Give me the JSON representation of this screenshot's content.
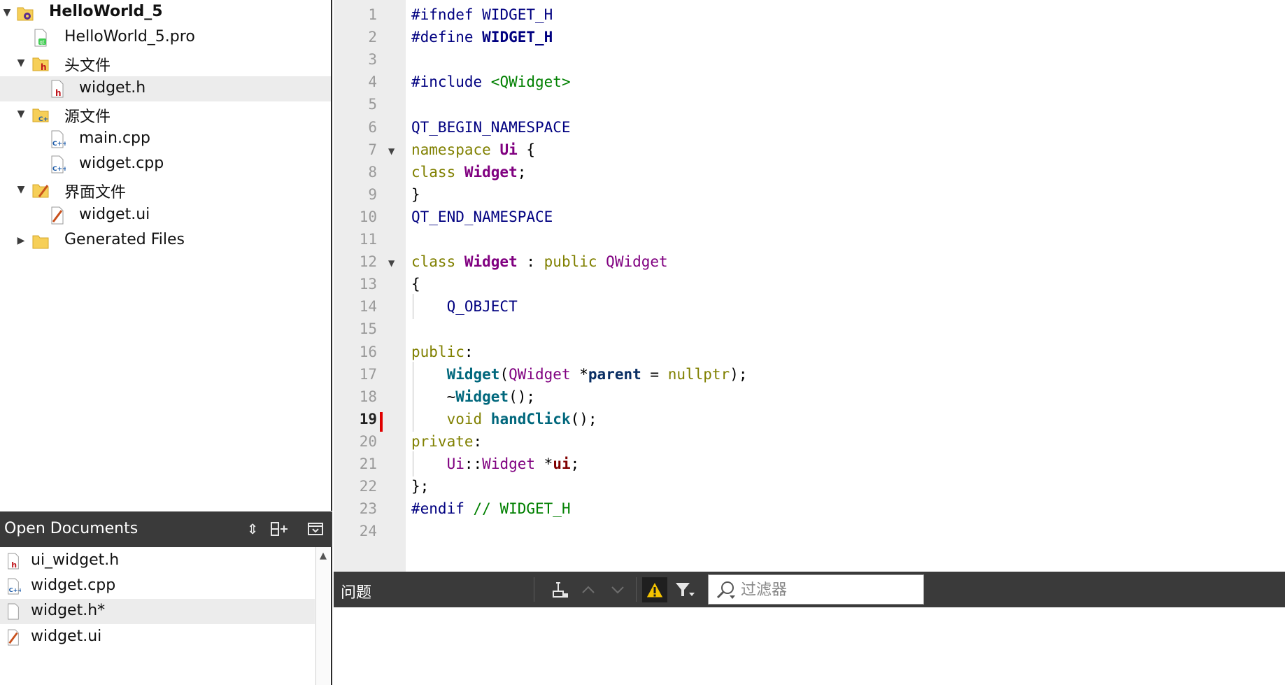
{
  "project_tree": {
    "items": [
      {
        "label": "HelloWorld_5",
        "icon": "qt-project-icon",
        "expanded": true
      },
      {
        "label": "HelloWorld_5.pro",
        "icon": "qt-pro-file-icon"
      },
      {
        "label": "头文件",
        "icon": "header-folder-icon",
        "expanded": true
      },
      {
        "label": "widget.h",
        "icon": "header-file-icon",
        "selected": true
      },
      {
        "label": "源文件",
        "icon": "source-folder-icon",
        "expanded": true
      },
      {
        "label": "main.cpp",
        "icon": "cpp-file-icon"
      },
      {
        "label": "widget.cpp",
        "icon": "cpp-file-icon"
      },
      {
        "label": "界面文件",
        "icon": "forms-folder-icon",
        "expanded": true
      },
      {
        "label": "widget.ui",
        "icon": "ui-file-icon"
      },
      {
        "label": "Generated Files",
        "icon": "folder-icon",
        "expanded": false
      }
    ]
  },
  "open_documents": {
    "title": "Open Documents",
    "items": [
      {
        "label": "ui_widget.h",
        "icon": "header-file-icon"
      },
      {
        "label": "widget.cpp",
        "icon": "cpp-file-icon"
      },
      {
        "label": "widget.h*",
        "icon": "blank-file-icon",
        "selected": true
      },
      {
        "label": "widget.ui",
        "icon": "ui-file-icon"
      }
    ]
  },
  "editor": {
    "current_line": 19,
    "line_numbers": [
      "1",
      "2",
      "3",
      "4",
      "5",
      "6",
      "7",
      "8",
      "9",
      "10",
      "11",
      "12",
      "13",
      "14",
      "15",
      "16",
      "17",
      "18",
      "19",
      "20",
      "21",
      "22",
      "23",
      "24"
    ],
    "lines": [
      [
        [
          "pp",
          "#ifndef "
        ],
        [
          "mac",
          "WIDGET_H"
        ]
      ],
      [
        [
          "pp",
          "#define "
        ],
        [
          "mac bold",
          "WIDGET_H"
        ]
      ],
      [],
      [
        [
          "pp",
          "#include "
        ],
        [
          "str",
          "<QWidget>"
        ]
      ],
      [],
      [
        [
          "mac",
          "QT_BEGIN_NAMESPACE"
        ]
      ],
      [
        [
          "kw",
          "namespace "
        ],
        [
          "ns bold",
          "Ui"
        ],
        [
          "pun",
          " {"
        ]
      ],
      [
        [
          "kw",
          "class "
        ],
        [
          "ty bold",
          "Widget"
        ],
        [
          "pun",
          ";"
        ]
      ],
      [
        [
          "pun",
          "}"
        ]
      ],
      [
        [
          "mac",
          "QT_END_NAMESPACE"
        ]
      ],
      [],
      [
        [
          "kw",
          "class "
        ],
        [
          "ty bold",
          "Widget"
        ],
        [
          "pun",
          " : "
        ],
        [
          "kw",
          "public "
        ],
        [
          "ty",
          "QWidget"
        ]
      ],
      [
        [
          "pun",
          "{"
        ]
      ],
      [
        [
          "pun",
          "    "
        ],
        [
          "mac",
          "Q_OBJECT"
        ]
      ],
      [],
      [
        [
          "kw",
          "public"
        ],
        [
          "pun",
          ":"
        ]
      ],
      [
        [
          "pun",
          "    "
        ],
        [
          "fn bold",
          "Widget"
        ],
        [
          "pun",
          "("
        ],
        [
          "ty",
          "QWidget"
        ],
        [
          "pun",
          " *"
        ],
        [
          "var",
          "parent"
        ],
        [
          "pun",
          " = "
        ],
        [
          "kw",
          "nullptr"
        ],
        [
          "pun",
          ");"
        ]
      ],
      [
        [
          "pun",
          "    ~"
        ],
        [
          "fn bold",
          "Widget"
        ],
        [
          "pun",
          "();"
        ]
      ],
      [
        [
          "pun",
          "    "
        ],
        [
          "kw",
          "void "
        ],
        [
          "fn bold",
          "handClick"
        ],
        [
          "pun",
          "();"
        ]
      ],
      [
        [
          "kw",
          "private"
        ],
        [
          "pun",
          ":"
        ]
      ],
      [
        [
          "pun",
          "    "
        ],
        [
          "ns",
          "Ui"
        ],
        [
          "pun",
          "::"
        ],
        [
          "ty",
          "Widget"
        ],
        [
          "pun",
          " *"
        ],
        [
          "mem",
          "ui"
        ],
        [
          "pun",
          ";"
        ]
      ],
      [
        [
          "pun",
          "};"
        ]
      ],
      [
        [
          "pp",
          "#endif "
        ],
        [
          "cmt",
          "// WIDGET_H"
        ]
      ],
      []
    ]
  },
  "issues": {
    "title": "问题",
    "filter_placeholder": "过滤器"
  },
  "colors": {
    "panel_dark": "#3a3a3a",
    "selection": "#ececec",
    "gutter": "#ededed",
    "change_marker": "#e00000"
  }
}
